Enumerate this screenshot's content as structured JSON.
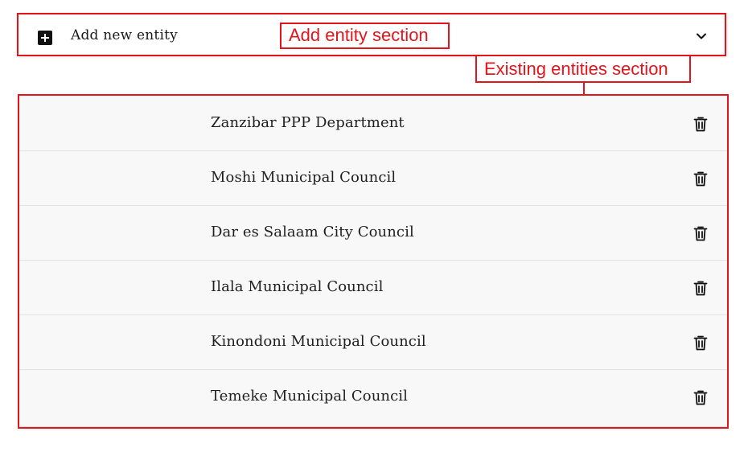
{
  "add_section": {
    "label": "Add new entity",
    "plus_icon": "plus-square-icon",
    "expand_icon": "chevron-down-icon"
  },
  "annotations": {
    "add_section": "Add entity section",
    "existing_section": "Existing entities section",
    "color": "#e4141b"
  },
  "entities": [
    {
      "name": "Zanzibar PPP Department",
      "action_icon": "trash-icon"
    },
    {
      "name": "Moshi Municipal Council",
      "action_icon": "trash-icon"
    },
    {
      "name": "Dar es Salaam City Council",
      "action_icon": "trash-icon"
    },
    {
      "name": "Ilala Municipal Council",
      "action_icon": "trash-icon"
    },
    {
      "name": "Kinondoni Municipal Council",
      "action_icon": "trash-icon"
    },
    {
      "name": "Temeke Municipal Council",
      "action_icon": "trash-icon"
    }
  ]
}
